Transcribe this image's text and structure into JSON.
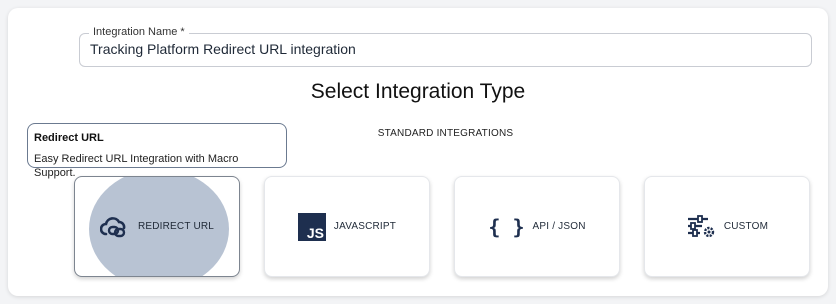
{
  "form": {
    "name_label": "Integration Name *",
    "name_value": "Tracking Platform Redirect URL integration"
  },
  "section": {
    "title": "Select Integration Type",
    "subtitle": "STANDARD INTEGRATIONS"
  },
  "tooltip": {
    "title": "Redirect URL",
    "text": "Easy Redirect URL Integration with Macro Support."
  },
  "cards": [
    {
      "label": "REDIRECT URL",
      "icon": "link-cloud-icon",
      "selected": true
    },
    {
      "label": "JAVASCRIPT",
      "icon": "js-icon",
      "badge": "JS",
      "selected": false
    },
    {
      "label": "API / JSON",
      "icon": "curly-braces-icon",
      "glyph": "{ }",
      "selected": false
    },
    {
      "label": "CUSTOM",
      "icon": "sliders-gear-icon",
      "selected": false
    }
  ],
  "colors": {
    "accent": "#1e2f4f",
    "selected_fill": "#b8c3d3"
  }
}
